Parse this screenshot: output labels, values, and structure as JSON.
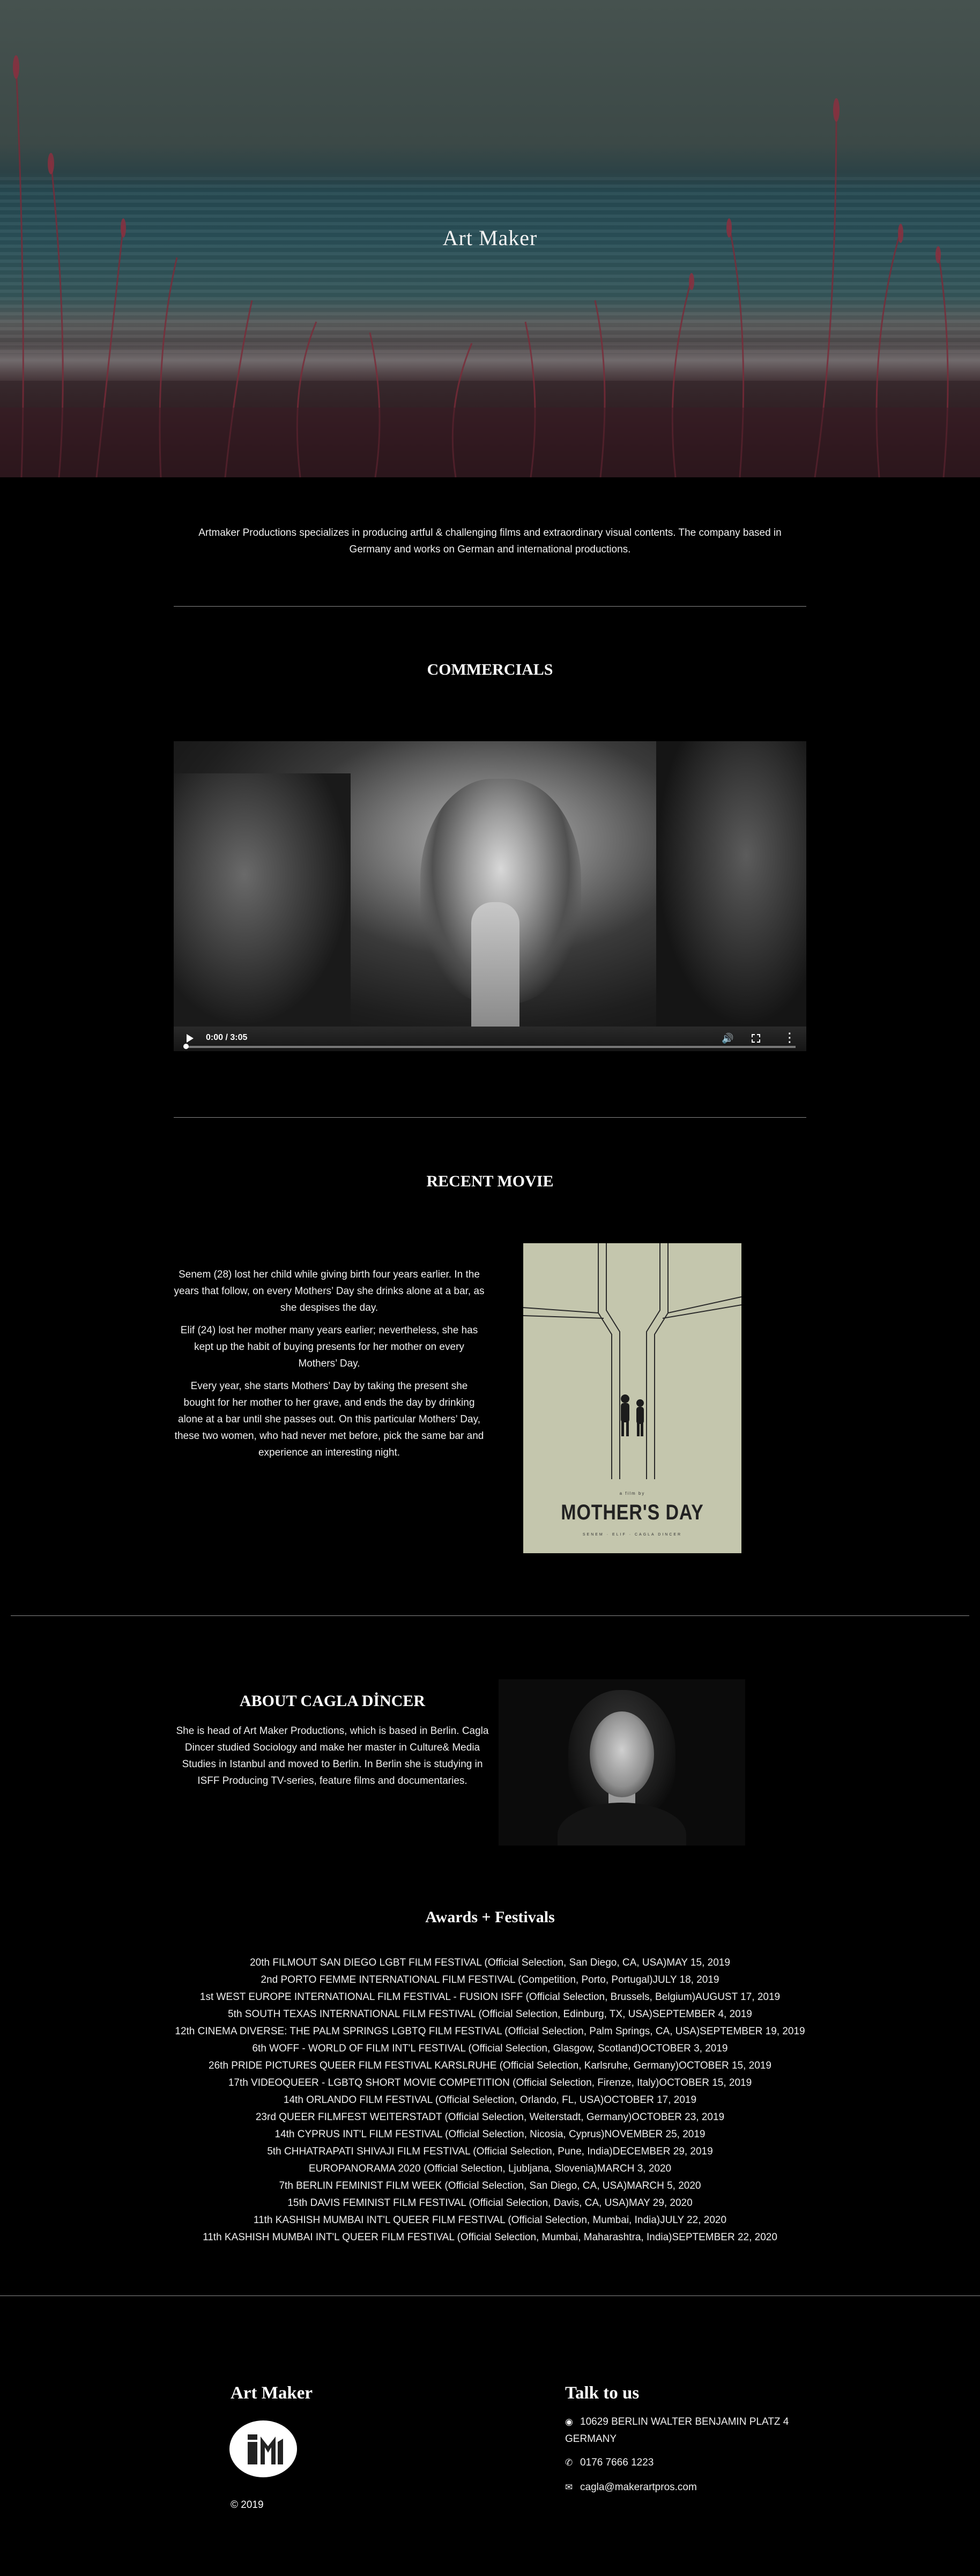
{
  "hero": {
    "title": "Art Maker"
  },
  "intro": {
    "text": "Artmaker Productions specializes in producing artful & challenging films and extraordinary visual contents. The company based in Germany and works on German and international productions."
  },
  "commercials": {
    "title": "COMMERCIALS",
    "video": {
      "time": "0:00 / 3:05",
      "progress": 0
    }
  },
  "recent_movie": {
    "title": "RECENT MOVIE",
    "paragraphs": [
      "Senem (28) lost her child while giving birth four years earlier. In the years that follow, on every Mothers’ Day she drinks alone at a bar, as she despises the day.",
      "Elif (24) lost her mother many years earlier; nevertheless, she has kept up the habit of buying presents for her mother on every Mothers’ Day.",
      "Every year, she starts Mothers’ Day by taking the present she bought for her mother to her grave, and ends the day by drinking alone at a bar until she passes out. On this particular Mothers’ Day, these two women, who had never met before, pick the same bar and experience an interesting night."
    ],
    "poster": {
      "small_text": "a film by",
      "title": "MOTHER'S DAY",
      "credits": "SENEM · ELIF · CAGLA DINCER"
    }
  },
  "about": {
    "title": "ABOUT CAGLA DİNCER",
    "text": "She is head of Art Maker Productions, which is based in Berlin. Cagla Dincer studied Sociology and make her master in Culture& Media Studies in Istanbul and moved to Berlin. In Berlin she is studying in ISFF Producing TV-series, feature films and documentaries."
  },
  "awards": {
    "title": "Awards + Festivals",
    "items": [
      "20th FILMOUT SAN DIEGO LGBT FILM FESTIVAL (Official Selection, San Diego, CA, USA)MAY 15, 2019",
      "2nd PORTO FEMME INTERNATIONAL FILM FESTIVAL (Competition, Porto, Portugal)JULY 18, 2019",
      "1st WEST EUROPE INTERNATIONAL FILM FESTIVAL - FUSION ISFF (Official Selection, Brussels, Belgium)AUGUST 17, 2019",
      "5th SOUTH TEXAS INTERNATIONAL FILM FESTIVAL (Official Selection, Edinburg, TX, USA)SEPTEMBER 4, 2019",
      "12th CINEMA DIVERSE: THE PALM SPRINGS LGBTQ FILM FESTIVAL (Official Selection, Palm Springs, CA, USA)SEPTEMBER 19, 2019",
      "6th WOFF - WORLD OF FILM INT'L FESTIVAL (Official Selection, Glasgow, Scotland)OCTOBER 3, 2019",
      "26th PRIDE PICTURES QUEER FILM FESTIVAL KARSLRUHE (Official Selection, Karlsruhe, Germany)OCTOBER 15, 2019",
      "17th VIDEOQUEER - LGBTQ SHORT MOVIE COMPETITION (Official Selection, Firenze, Italy)OCTOBER 15, 2019",
      "14th ORLANDO FILM FESTIVAL (Official Selection, Orlando, FL, USA)OCTOBER 17, 2019",
      "23rd QUEER FILMFEST WEITERSTADT (Official Selection, Weiterstadt, Germany)OCTOBER 23, 2019",
      "14th CYPRUS INT'L FILM FESTIVAL (Official Selection, Nicosia, Cyprus)NOVEMBER 25, 2019",
      "5th CHHATRAPATI SHIVAJI FILM FESTIVAL (Official Selection, Pune, India)DECEMBER 29, 2019",
      "EUROPANORAMA 2020 (Official Selection, Ljubljana, Slovenia)MARCH 3, 2020",
      "7th BERLIN FEMINIST FILM WEEK (Official Selection, San Diego, CA, USA)MARCH 5, 2020",
      "15th DAVIS FEMINIST FILM FESTIVAL (Official Selection, Davis, CA, USA)MAY 29, 2020",
      "11th KASHISH MUMBAI INT'L QUEER FILM FESTIVAL (Official Selection, Mumbai, India)JULY 22, 2020",
      "11th KASHISH MUMBAI INT'L QUEER FILM FESTIVAL (Official Selection, Mumbai, Maharashtra, India)SEPTEMBER 22, 2020"
    ]
  },
  "footer": {
    "brand": "Art Maker",
    "copyright": "© 2019",
    "talk_title": "Talk to us",
    "address": "10629 BERLIN WALTER BENJAMIN PLATZ 4 GERMANY",
    "phone": "0176 7666 1223",
    "email": "cagla@makerartpros.com",
    "icons": {
      "address": "location-icon",
      "phone": "phone-icon",
      "email": "envelope-icon"
    }
  }
}
